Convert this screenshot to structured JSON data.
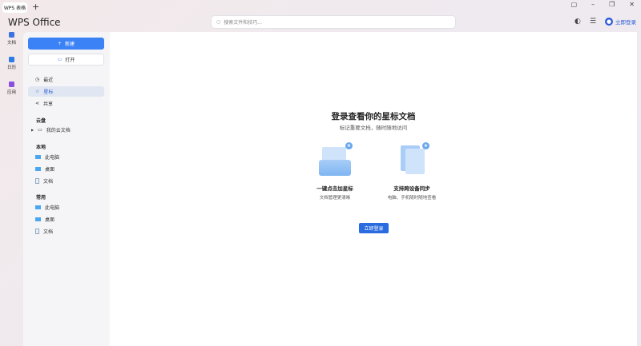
{
  "window": {
    "tab_label": "WPS 表格",
    "new_tab": "+",
    "brand": "WPS Office"
  },
  "search": {
    "placeholder": "搜索文件和技巧..."
  },
  "topbar": {
    "login_label": "立即登录"
  },
  "rail": [
    {
      "label": "文档",
      "color": "#3b72e0"
    },
    {
      "label": "日历",
      "color": "#2d7be6"
    },
    {
      "label": "应用",
      "color": "#8b4fe0"
    }
  ],
  "sidebar": {
    "new_label": "新建",
    "open_label": "打开",
    "nav": [
      {
        "label": "最近",
        "icon": "clock-icon"
      },
      {
        "label": "星标",
        "icon": "star-icon"
      },
      {
        "label": "共享",
        "icon": "share-icon"
      }
    ],
    "cloud": {
      "title": "云盘",
      "items": [
        {
          "label": "我的云文档"
        }
      ]
    },
    "local": {
      "title": "本地",
      "items": [
        {
          "label": "此电脑"
        },
        {
          "label": "桌面"
        },
        {
          "label": "文档"
        }
      ]
    },
    "common": {
      "title": "常用",
      "items": [
        {
          "label": "此电脑"
        },
        {
          "label": "桌面"
        },
        {
          "label": "文档"
        }
      ]
    }
  },
  "main": {
    "title": "登录查看你的星标文档",
    "subtitle": "标记重要文档，随时随地访问",
    "features": [
      {
        "title": "一键点击加星标",
        "desc": "文档管理更清晰"
      },
      {
        "title": "支持跨设备同步",
        "desc": "电脑、手机随时随地查看"
      }
    ],
    "login_button": "立即登录"
  }
}
